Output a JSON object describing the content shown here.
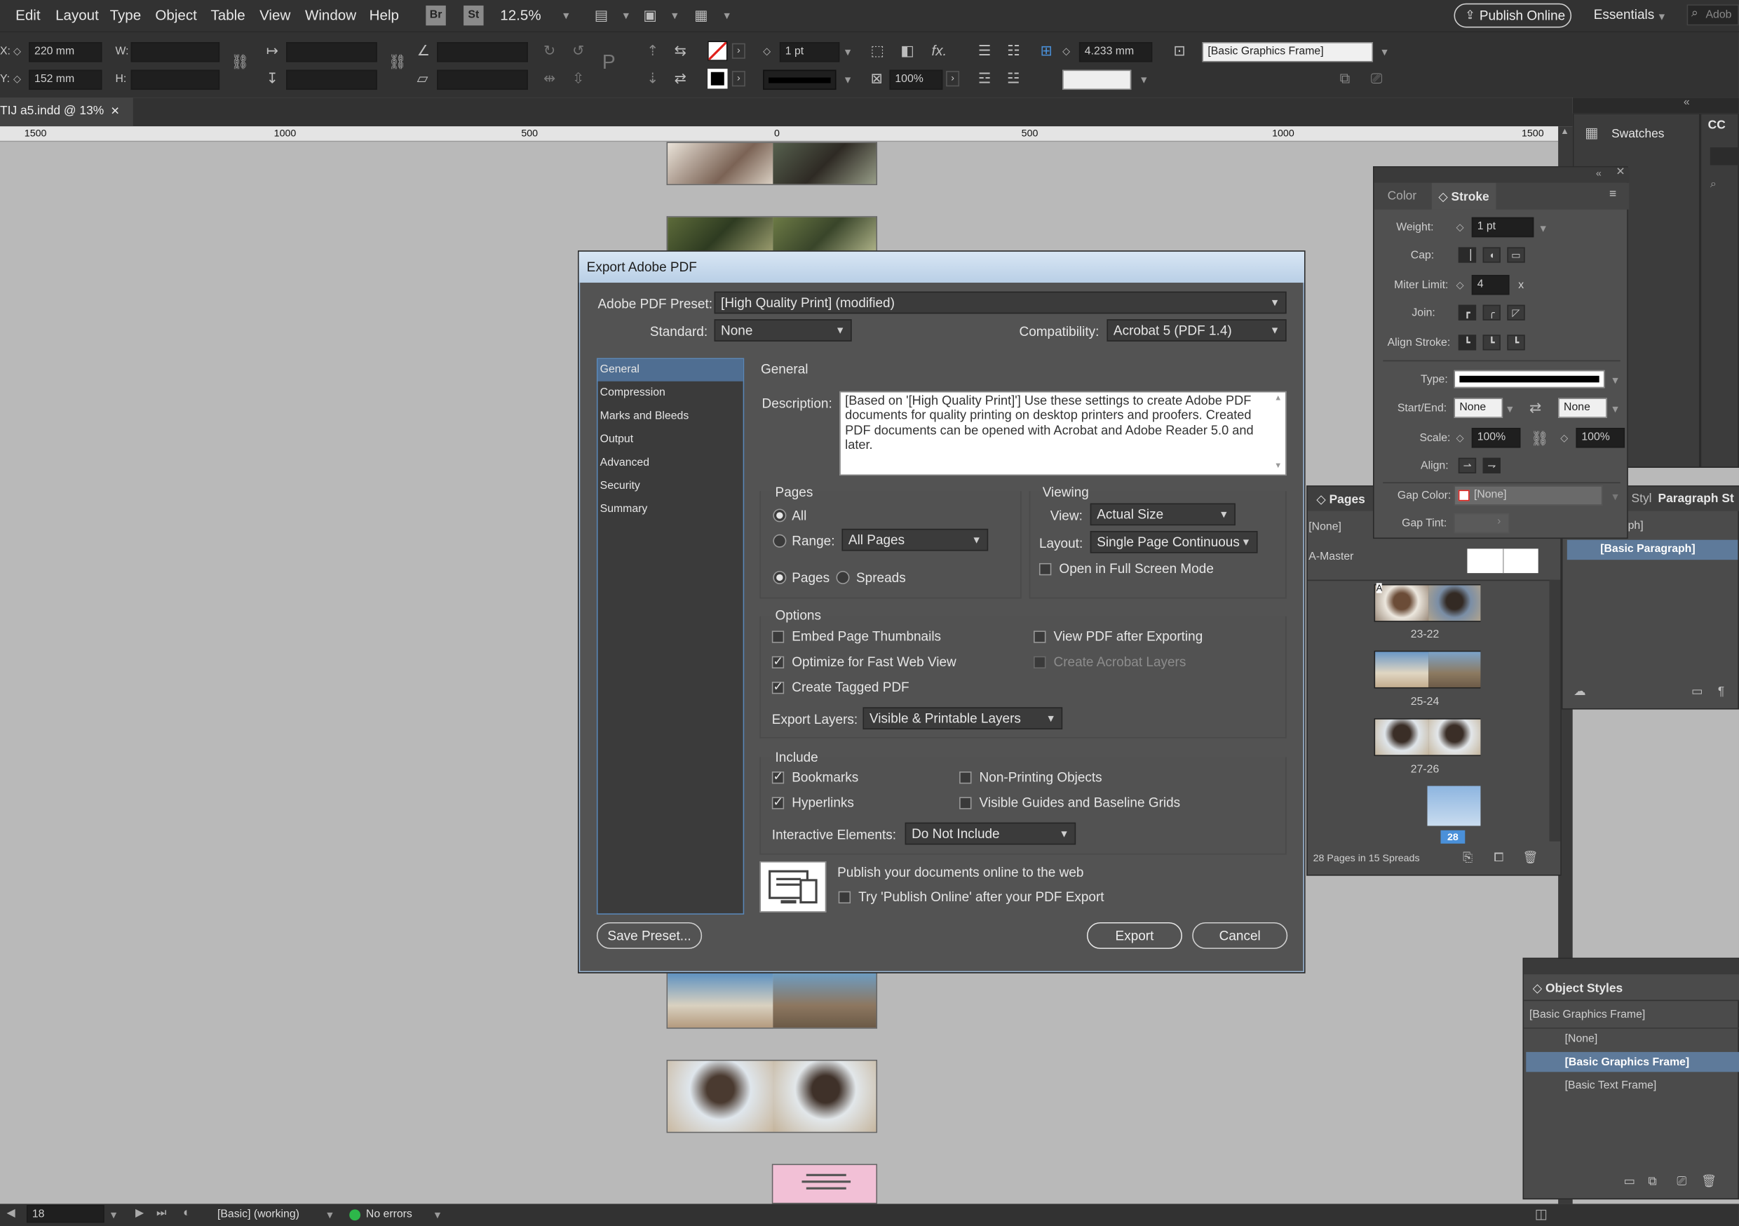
{
  "menu": [
    "Edit",
    "Layout",
    "Type",
    "Object",
    "Table",
    "View",
    "Window",
    "Help"
  ],
  "appbar": {
    "br": "Br",
    "st": "St",
    "zoom": "12.5%",
    "publish_online": "Publish Online",
    "workspace": "Essentials",
    "search_placeholder": "Adob"
  },
  "control": {
    "x_label": "X:",
    "x_value": "220 mm",
    "y_label": "Y:",
    "y_value": "152 mm",
    "w_label": "W:",
    "h_label": "H:",
    "stroke_weight": "1 pt",
    "opacity": "100%",
    "gap": "4.233 mm",
    "object_style": "[Basic Graphics Frame]"
  },
  "doc_tab": {
    "title": "TIJ a5.indd @ 13%",
    "close": "×"
  },
  "ruler": [
    "1500",
    "1000",
    "500",
    "0",
    "500",
    "1000",
    "1500"
  ],
  "dialog": {
    "title": "Export Adobe PDF",
    "preset_label": "Adobe PDF Preset:",
    "preset": "[High Quality Print] (modified)",
    "standard_label": "Standard:",
    "standard": "None",
    "compat_label": "Compatibility:",
    "compat": "Acrobat 5 (PDF 1.4)",
    "nav": [
      "General",
      "Compression",
      "Marks and Bleeds",
      "Output",
      "Advanced",
      "Security",
      "Summary"
    ],
    "section": "General",
    "desc_label": "Description:",
    "description": "[Based on '[High Quality Print]'] Use these settings to create Adobe PDF documents for quality printing on desktop printers and proofers. Created PDF documents can be opened with Acrobat and Adobe Reader 5.0 and later.",
    "pages_title": "Pages",
    "all": "All",
    "range_label": "Range:",
    "range": "All Pages",
    "pages_opt": "Pages",
    "spreads_opt": "Spreads",
    "viewing_title": "Viewing",
    "view_label": "View:",
    "view": "Actual Size",
    "layout_label": "Layout:",
    "layout": "Single Page Continuous",
    "fullscreen": "Open in Full Screen Mode",
    "options_title": "Options",
    "embed": "Embed Page Thumbnails",
    "optimize": "Optimize for Fast Web View",
    "tagged": "Create Tagged PDF",
    "view_after": "View PDF after Exporting",
    "acrobat_layers": "Create Acrobat Layers",
    "export_layers_label": "Export Layers:",
    "export_layers": "Visible & Printable Layers",
    "include_title": "Include",
    "bookmarks": "Bookmarks",
    "hyperlinks": "Hyperlinks",
    "nonprinting": "Non-Printing Objects",
    "guides": "Visible Guides and Baseline Grids",
    "interactive_label": "Interactive Elements:",
    "interactive": "Do Not Include",
    "publish_text": "Publish your documents online to the web",
    "publish_try": "Try 'Publish Online' after your PDF Export",
    "save_preset": "Save Preset...",
    "export": "Export",
    "cancel": "Cancel"
  },
  "stroke_panel": {
    "tab_color": "Color",
    "tab_stroke": "Stroke",
    "weight_label": "Weight:",
    "weight": "1 pt",
    "cap_label": "Cap:",
    "miter_label": "Miter Limit:",
    "miter": "4",
    "miter_x": "x",
    "join_label": "Join:",
    "align_label": "Align Stroke:",
    "type_label": "Type:",
    "startend_label": "Start/End:",
    "start": "None",
    "end": "None",
    "scale_label": "Scale:",
    "scale1": "100%",
    "scale2": "100%",
    "alignarrow_label": "Align:",
    "gapcolor_label": "Gap Color:",
    "gapcolor": "[None]",
    "gaptint_label": "Gap Tint:"
  },
  "swatches": {
    "title": "Swatches",
    "cc": "CC"
  },
  "pages_panel": {
    "title": "Pages",
    "styles_tab": "Styl",
    "none": "[None]",
    "master": "A-Master",
    "labels": [
      "23-22",
      "25-24",
      "27-26"
    ],
    "current": "28",
    "footer": "28 Pages in 15 Spreads"
  },
  "para_panel": {
    "title": "Paragraph St",
    "item1": "raph]",
    "item2": "[Basic Paragraph]"
  },
  "object_styles": {
    "title": "Object Styles",
    "current": "[Basic Graphics Frame]",
    "items": [
      "[None]",
      "[Basic Graphics Frame]",
      "[Basic Text Frame]"
    ]
  },
  "status": {
    "page": "18",
    "master": "[Basic] (working)",
    "errors": "No errors"
  },
  "colors": {
    "ui_dark": "#323232",
    "panel": "#4b4b4b",
    "dialog": "#535353",
    "accent_blue": "#4a90d9",
    "selected_row": "#5e7a9a",
    "ok_green": "#2db84a"
  }
}
